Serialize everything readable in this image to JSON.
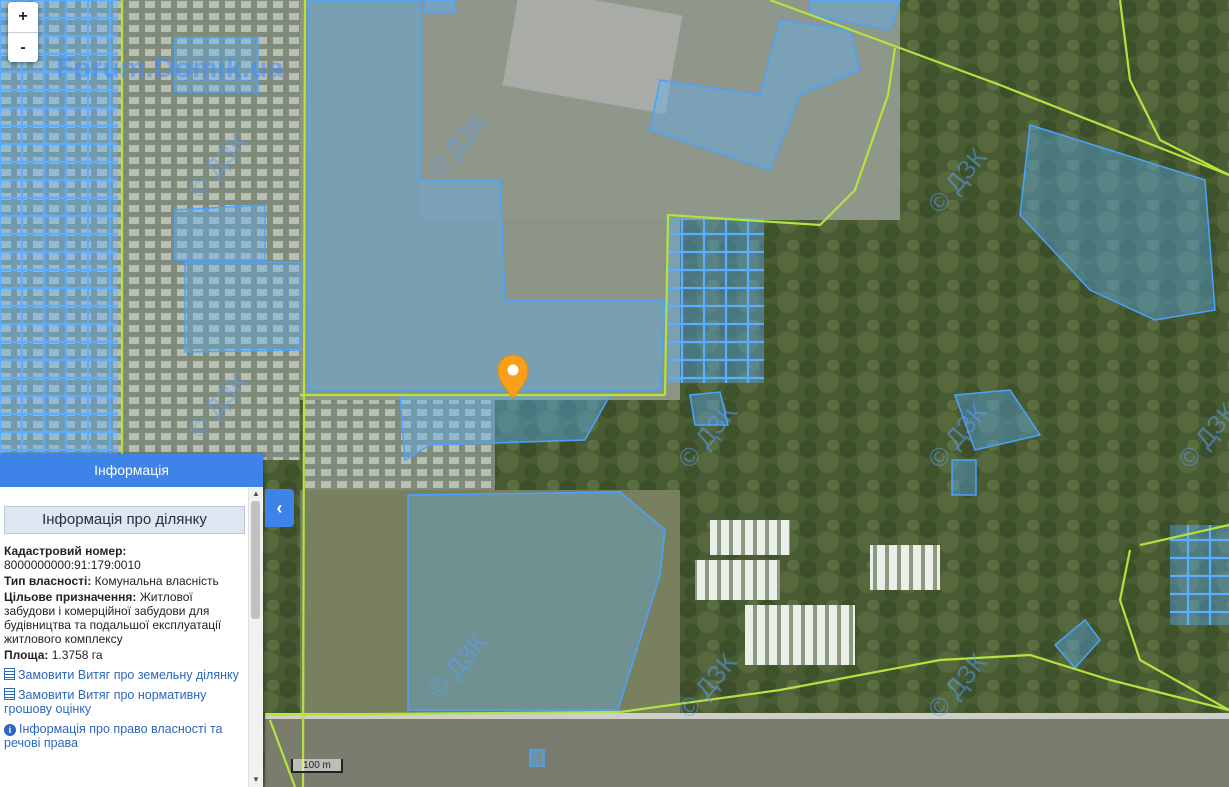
{
  "map": {
    "watermark_text": "Forum.Domik.ua",
    "copyright_mark": "© ДЗК",
    "scale_label": "100 m",
    "colors": {
      "parcel_fill": "#5bb4ff",
      "parcel_stroke": "#4aa3ff",
      "boundary_line": "#b4e33d",
      "marker": "#f9a01b"
    }
  },
  "zoom": {
    "in_label": "+",
    "out_label": "-"
  },
  "info_panel": {
    "header": "Інформація",
    "title": "Інформація про ділянку",
    "cadastral_label": "Кадастровий номер:",
    "cadastral_value": "8000000000:91:179:0010",
    "ownership_label": "Тип власності:",
    "ownership_value": "Комунальна власність",
    "purpose_label": "Цільове призначення:",
    "purpose_value": "Житлової забудови і комерційної забудови для будівництва та подальшої експлуатації житлового комплексу",
    "area_label": "Площа:",
    "area_value": "1.3758 га",
    "links": [
      {
        "icon": "document-icon",
        "text": "Замовити Витяг про земельну ділянку"
      },
      {
        "icon": "document-icon",
        "text": "Замовити Витяг про нормативну грошову оцінку"
      },
      {
        "icon": "info-icon",
        "text": "Інформація про право власності та речові права"
      }
    ]
  },
  "collapse_icon": "chevron-left-icon"
}
